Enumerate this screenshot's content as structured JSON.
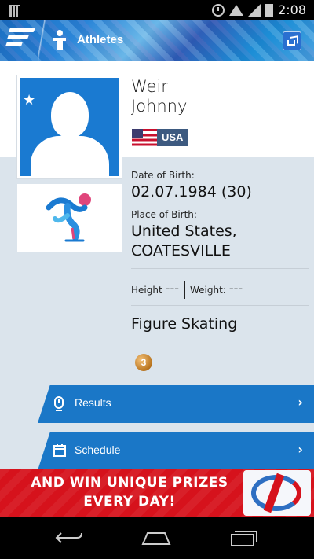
{
  "status_bar": {
    "time": "2:08"
  },
  "app_bar": {
    "title": "Athletes"
  },
  "athlete": {
    "last_name": "Weir",
    "first_name": "Johnny",
    "country_code": "USA",
    "dob_label": "Date of Birth:",
    "dob_value": "02.07.1984 (30)",
    "pob_label": "Place of Birth:",
    "pob_line1": "United States,",
    "pob_line2": "COATESVILLE",
    "height_label": "Height",
    "height_value": "---",
    "weight_label": "Weight:",
    "weight_value": "---",
    "sport": "Figure Skating",
    "medal_count": "3"
  },
  "buttons": {
    "results": "Results",
    "schedule": "Schedule",
    "arrow": "›"
  },
  "ad": {
    "line1": "AND WIN UNIQUE PRIZES",
    "line2": "EVERY DAY!"
  },
  "icons": [
    "menu-icon",
    "athlete-icon",
    "share-icon",
    "star-icon",
    "figure-skating-icon",
    "results-icon",
    "schedule-icon",
    "back-icon",
    "home-icon",
    "recent-apps-icon"
  ]
}
